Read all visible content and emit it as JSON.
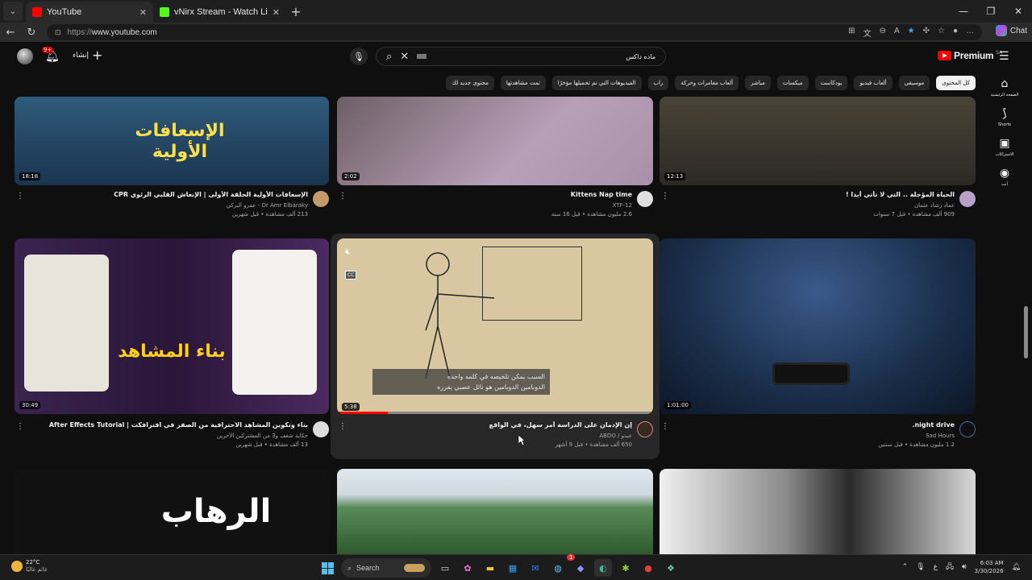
{
  "browser": {
    "tabs": [
      {
        "title": "YouTube",
        "active": true,
        "favicon_color": "#ff0000"
      },
      {
        "title": "vNirx Stream - Watch Live on Kick",
        "active": false,
        "favicon_color": "#53fc18"
      }
    ],
    "url_scheme": "https://",
    "url_host": "www.youtube.com",
    "chat_label": "Chat"
  },
  "header": {
    "notification_count": "9+",
    "create_label": "إنشاء",
    "search_query": "ماده داكس",
    "logo_text": "Premium",
    "logo_region": "SA"
  },
  "chips": [
    {
      "label": "كل المحتوى",
      "selected": true
    },
    {
      "label": "موسيقى"
    },
    {
      "label": "ألعاب فيديو"
    },
    {
      "label": "بودكاست"
    },
    {
      "label": "ميكسات"
    },
    {
      "label": "مباشر"
    },
    {
      "label": "ألعاب مغامرات وحركة"
    },
    {
      "label": "راب"
    },
    {
      "label": "الفيديوهات التي تم تحميلها مؤخرًا"
    },
    {
      "label": "تمت مشاهدتها"
    },
    {
      "label": "محتوى جديد لك"
    }
  ],
  "sidenav": [
    {
      "label": "الصفحة الرئيسية",
      "icon": "home-icon"
    },
    {
      "label": "Shorts",
      "icon": "shorts-icon"
    },
    {
      "label": "الاشتراكات",
      "icon": "subscriptions-icon"
    },
    {
      "label": "أنت",
      "icon": "you-icon"
    }
  ],
  "videos": [
    {
      "title": "الحياة المؤجلة .. التي لا تأتي أبدا !",
      "channel": "عماد رشاد عثمان",
      "stats": "909 ألف مشاهدة • قبل 7 سنوات",
      "duration": "12:13",
      "thumb_color": "#3d3a30"
    },
    {
      "title": "Kittens Nap time",
      "channel": "XTF-12",
      "stats": "2.6 مليون مشاهدة • قبل 16 سنة",
      "duration": "2:02",
      "thumb_color": "#8a7a8a"
    },
    {
      "title": "الإسعافات الأولية الحلقة الأولى | الإنعاش القلبي الرئوي CPR",
      "channel": "Dr Amr Elbaraky - عمرو البركي",
      "stats": "213 ألف مشاهدة • قبل شهرين",
      "duration": "18:18",
      "thumb_color": "#1f3a55",
      "thumb_text": "الإسعافات الأولية"
    },
    {
      "title": "night drive.",
      "channel": "Sad Hours",
      "stats": "1.2 مليون مشاهدة • قبل سنتين",
      "duration": "1:01:00",
      "thumb_color": "#1a2e4a"
    },
    {
      "title": "إن الإدمان على الدراسة أمر سهل، في الواقع",
      "channel": "عبدو / ABDO",
      "stats": "650 ألف مشاهدة • قبل 9 أشهر",
      "duration": "5:38",
      "thumb_color": "#d8c7a0",
      "caption_line1": "السبب يمكن تلخيصه في كلمه واحده",
      "caption_line2": "الدوبامين الدوبامين هو نائل عصبي يفرزه"
    },
    {
      "title": "بناء وتكوين المشاهد الاحترافية من الصفر في افترافكت | After Effects Tutorial",
      "channel": "حكاية شغف و3 من المشتركين الآخرين",
      "stats": "13 ألف مشاهدة • قبل شهرين",
      "duration": "30:49",
      "thumb_color": "#3a2450",
      "thumb_text": "بناء المشاهد"
    },
    {
      "title": "",
      "channel": "",
      "stats": "",
      "duration": "",
      "thumb_color": "#d9d9d9"
    },
    {
      "title": "",
      "channel": "",
      "stats": "",
      "duration": "",
      "thumb_color": "#3e6b3a"
    },
    {
      "title": "",
      "channel": "",
      "stats": "",
      "duration": "",
      "thumb_color": "#111111",
      "thumb_text": "الرهاب"
    }
  ],
  "taskbar": {
    "temp": "22°C",
    "weather_desc": "غائم غالبًا",
    "search_label": "Search",
    "time": "6:03 AM",
    "date": "3/30/2026",
    "notification_badge": "1"
  }
}
